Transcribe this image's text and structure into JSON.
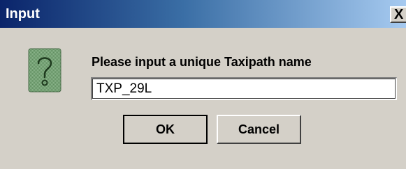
{
  "window": {
    "title": "Input",
    "close_glyph": "X"
  },
  "icon": "question-icon",
  "prompt": "Please input a unique Taxipath name",
  "input": {
    "value": "TXP_29L"
  },
  "buttons": {
    "ok": "OK",
    "cancel": "Cancel"
  }
}
